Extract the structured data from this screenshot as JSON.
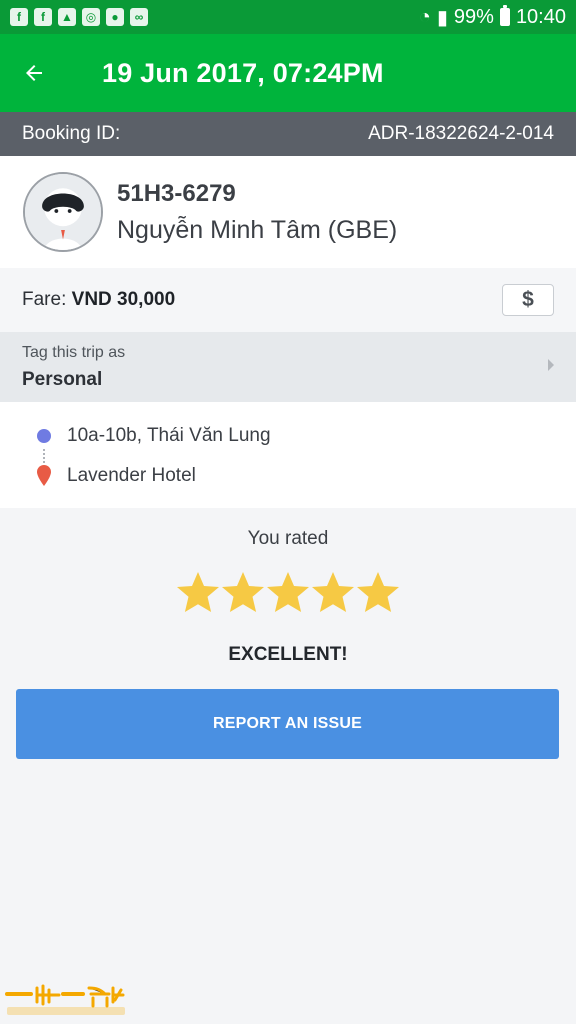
{
  "status_bar": {
    "battery": "99%",
    "time": "10:40",
    "icons": [
      "facebook-icon",
      "facebook-icon",
      "gallery-icon",
      "instagram-icon",
      "calendar-icon",
      "grab-icon",
      "wifi-icon",
      "signal-icon",
      "battery-icon"
    ]
  },
  "header": {
    "title": "19 Jun 2017, 07:24PM",
    "back_icon": "arrow-left-icon"
  },
  "booking": {
    "label": "Booking ID:",
    "id": "ADR-18322624-2-014"
  },
  "driver": {
    "plate": "51H3-6279",
    "name": "Nguyễn Minh Tâm (GBE)"
  },
  "fare": {
    "label": "Fare:",
    "value": "VND 30,000",
    "payment_icon": "$"
  },
  "tag": {
    "label": "Tag this trip as",
    "value": "Personal"
  },
  "route": {
    "pickup": "10a-10b, Thái Văn Lung",
    "dropoff": "Lavender Hotel"
  },
  "rating": {
    "label": "You rated",
    "stars": 5,
    "max_stars": 5,
    "word": "EXCELLENT!"
  },
  "actions": {
    "report_label": "REPORT AN ISSUE"
  },
  "watermark": {
    "text": "一世一香港 141hongkong.com"
  },
  "colors": {
    "status_bar": "#0a9a37",
    "header": "#00b43c",
    "booking_bar": "#5b6068",
    "star": "#f6c944",
    "button": "#4a90e2",
    "pickup": "#6f7be2",
    "dropoff": "#e85b45"
  }
}
